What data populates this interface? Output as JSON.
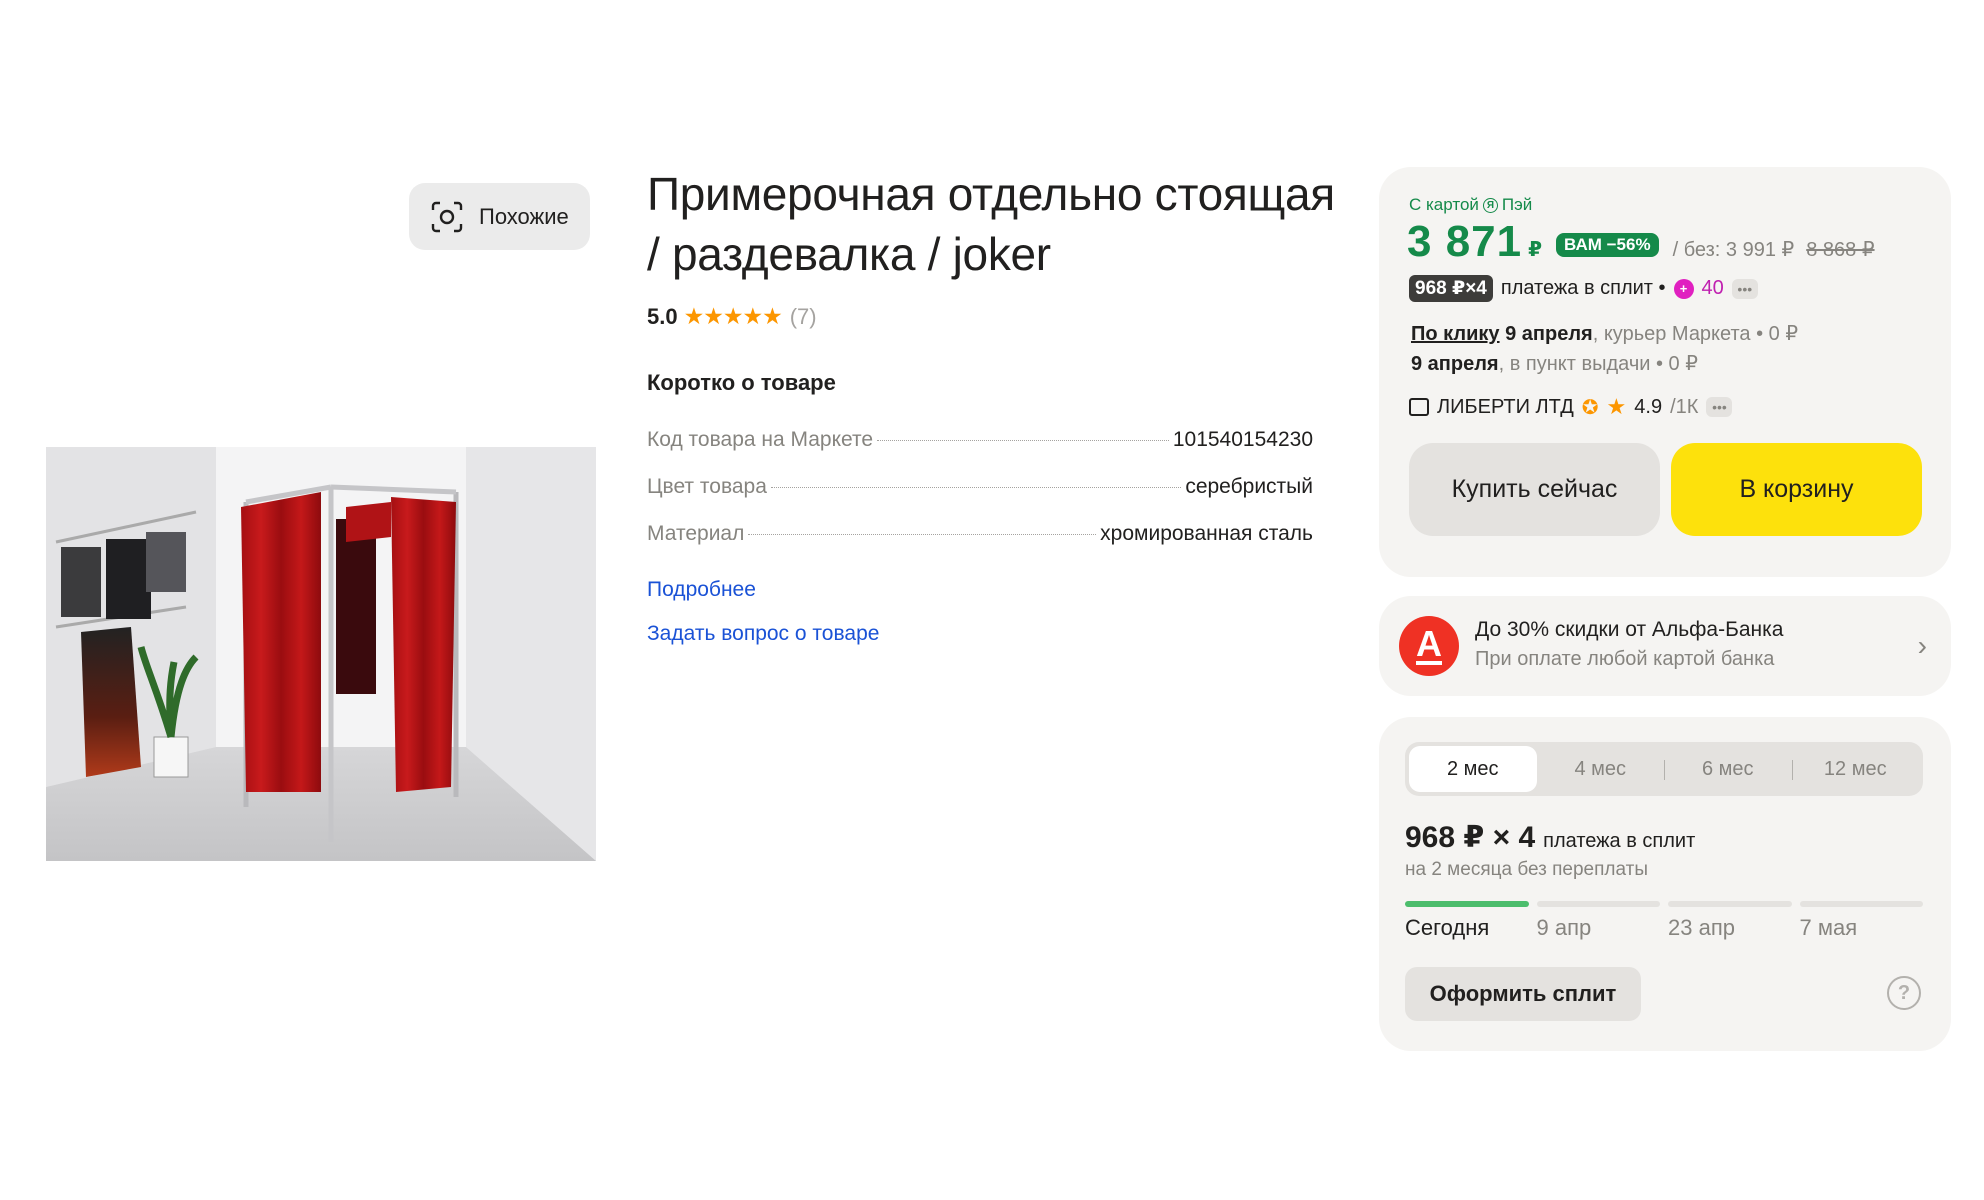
{
  "similar": {
    "label": "Похожие",
    "icon": "camera-search-icon"
  },
  "product": {
    "title": "Примерочная отдельно стоящая / раздевалка / joker",
    "rating": "5.0",
    "rating_count": "(7)",
    "stars": "★★★★★",
    "image_alt": "fitting-room-photo"
  },
  "summary": {
    "title": "Коротко о товаре",
    "specs": [
      {
        "key": "Код товара на Маркете",
        "value": "101540154230"
      },
      {
        "key": "Цвет товара",
        "value": "серебристый"
      },
      {
        "key": "Материал",
        "value": "хромированная сталь"
      }
    ],
    "more_link": "Подробнее",
    "ask_link": "Задать вопрос о товаре"
  },
  "buy_box": {
    "card_label": "С картой",
    "card_brand": "Пэй",
    "price": "3 871",
    "currency": "₽",
    "discount_badge": "ВАМ −56%",
    "price_without": "/ без: 3 991 ₽",
    "price_old": "8 868 ₽",
    "split_badge": "968 ₽×4",
    "split_text": "платежа в сплит •",
    "plus_points": "40",
    "delivery_click_label": "По клику",
    "delivery_click_date": "9 апреля",
    "delivery_click_rest": ", курьер Маркета • 0 ₽",
    "delivery_pickup_date": "9 апреля",
    "delivery_pickup_rest": ", в пункт выдачи • 0 ₽",
    "seller_name": "ЛИБЕРТИ ЛТД",
    "seller_rating": "4.9",
    "seller_reviews": "/1К",
    "buy_now": "Купить сейчас",
    "add_to_cart": "В корзину"
  },
  "promo": {
    "logo_letter": "А",
    "title": "До 30% скидки от Альфа-Банка",
    "subtitle": "При оплате любой картой банка"
  },
  "split": {
    "tabs": [
      "2 мес",
      "4 мес",
      "6 мес",
      "12 мес"
    ],
    "active_tab": 0,
    "amount": "968 ₽ × 4",
    "amount_text": "платежа в сплит",
    "note": "на 2 месяца без переплаты",
    "dates": [
      "Сегодня",
      "9 апр",
      "23 апр",
      "7 мая"
    ],
    "paid_parts": 1,
    "button": "Оформить сплит"
  },
  "colors": {
    "green": "#158a4a",
    "yellow": "#fde10c",
    "link": "#1a52d6",
    "alfa_red": "#ef3124"
  }
}
